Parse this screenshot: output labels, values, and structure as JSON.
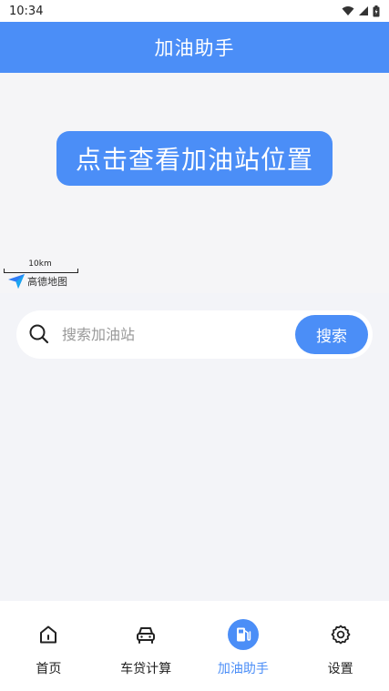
{
  "status_bar": {
    "time": "10:34"
  },
  "app_bar": {
    "title": "加油助手"
  },
  "map": {
    "locate_button_label": "点击查看加油站位置",
    "scale_label": "10km",
    "logo_text": "高德地图"
  },
  "search": {
    "placeholder": "搜索加油站",
    "value": "",
    "button_label": "搜索"
  },
  "bottom_nav": {
    "items": [
      {
        "label": "首页",
        "icon": "home-icon",
        "active": false
      },
      {
        "label": "车贷计算",
        "icon": "car-icon",
        "active": false
      },
      {
        "label": "加油助手",
        "icon": "fuel-pump-icon",
        "active": true
      },
      {
        "label": "设置",
        "icon": "gear-icon",
        "active": false
      }
    ]
  },
  "colors": {
    "accent": "#4b8ef7",
    "background": "#f3f4f8"
  }
}
